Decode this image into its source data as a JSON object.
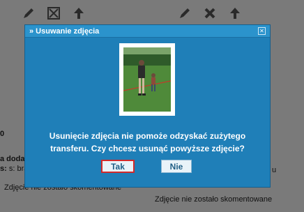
{
  "dialog": {
    "title": "» Usuwanie zdjęcia",
    "message_line1": "Usunięcie zdjęcia nie pomoże odzyskać zużytego",
    "message_line2": "transferu. Czy chcesz usunąć powyższe zdjęcie?",
    "yes_label": "Tak",
    "no_label": "Nie"
  },
  "background": {
    "left_label_partial": "a doda",
    "left_label_partial2": "s: brak",
    "left_digit": "0",
    "right_suffix": "u",
    "comment_left": "Zdjęcie nie zostało skomentowane",
    "comment_right": "Zdjęcie nie zostało skomentowane"
  },
  "icons": {
    "toolbar_left": [
      "edit-icon",
      "resize-icon",
      "upload-icon"
    ],
    "toolbar_right": [
      "edit-icon",
      "delete-icon",
      "upload-icon"
    ]
  },
  "colors": {
    "dialog_bg": "#1f7fb8",
    "header_bg": "#2b93cc",
    "highlight": "#d22a2a"
  }
}
